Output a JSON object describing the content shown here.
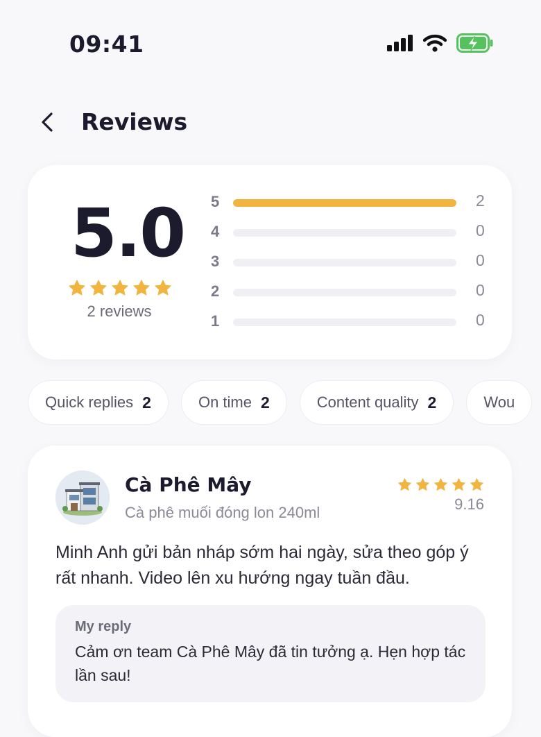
{
  "status_bar": {
    "time": "09:41"
  },
  "header": {
    "title": "Reviews"
  },
  "summary": {
    "score": "5.0",
    "star_rating": 5,
    "reviews_label": "2 reviews",
    "star_color": "#f1b43f",
    "bars": [
      {
        "stars": "5",
        "count": "2",
        "fraction": 1.0
      },
      {
        "stars": "4",
        "count": "0",
        "fraction": 0
      },
      {
        "stars": "3",
        "count": "0",
        "fraction": 0
      },
      {
        "stars": "2",
        "count": "0",
        "fraction": 0
      },
      {
        "stars": "1",
        "count": "0",
        "fraction": 0
      }
    ]
  },
  "chips": [
    {
      "label": "Quick replies",
      "count": "2"
    },
    {
      "label": "On time",
      "count": "2"
    },
    {
      "label": "Content quality",
      "count": "2"
    },
    {
      "label": "Wou",
      "count": ""
    }
  ],
  "review": {
    "name": "Cà Phê Mây",
    "product": "Cà phê muối đóng lon 240ml",
    "star_rating": 5,
    "score": "9.16",
    "text": "Minh Anh gửi bản nháp sớm hai ngày, sửa theo góp ý rất nhanh. Video lên xu hướng ngay tuần đầu.",
    "reply": {
      "label": "My reply",
      "text": "Cảm ơn team Cà Phê Mây đã tin tưởng ạ. Hẹn hợp tác lần sau!"
    }
  }
}
